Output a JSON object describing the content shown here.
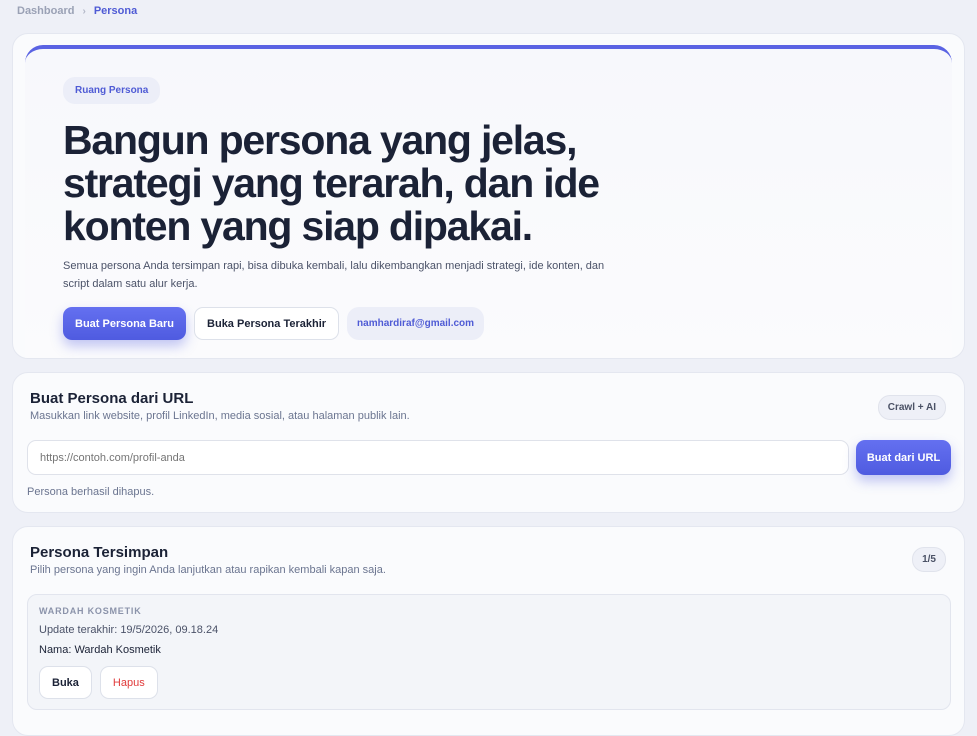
{
  "breadcrumb": {
    "parent": "Dashboard",
    "separator": "›",
    "current": "Persona"
  },
  "hero": {
    "pill": "Ruang Persona",
    "title_lines": [
      "Bangun persona yang jelas,",
      "strategi yang terarah, dan ide",
      "konten yang siap dipakai."
    ],
    "description": "Semua persona Anda tersimpan rapi, bisa dibuka kembali, lalu dikembangkan menjadi strategi, ide konten, dan script dalam satu alur kerja.",
    "primary_button": "Buat Persona Baru",
    "secondary_button": "Buka Persona Terakhir",
    "email": "namhardiraf@gmail.com"
  },
  "url_section": {
    "title": "Buat Persona dari URL",
    "subtitle": "Masukkan link website, profil LinkedIn, media sosial, atau halaman publik lain.",
    "badge": "Crawl + AI",
    "input_placeholder": "https://contoh.com/profil-anda",
    "input_value": "",
    "button": "Buat dari URL",
    "status": "Persona berhasil dihapus."
  },
  "saved_section": {
    "title": "Persona Tersimpan",
    "subtitle": "Pilih persona yang ingin Anda lanjutkan atau rapikan kembali kapan saja.",
    "count_badge": "1/5",
    "items": [
      {
        "brand": "WARDAH KOSMETIK",
        "updated": "Update terakhir: 19/5/2026, 09.18.24",
        "name": "Nama: Wardah Kosmetik",
        "open_label": "Buka",
        "delete_label": "Hapus"
      }
    ]
  },
  "colors": {
    "accent": "#4f5bd5",
    "background": "#eef0f7",
    "danger": "#e03a3a"
  }
}
